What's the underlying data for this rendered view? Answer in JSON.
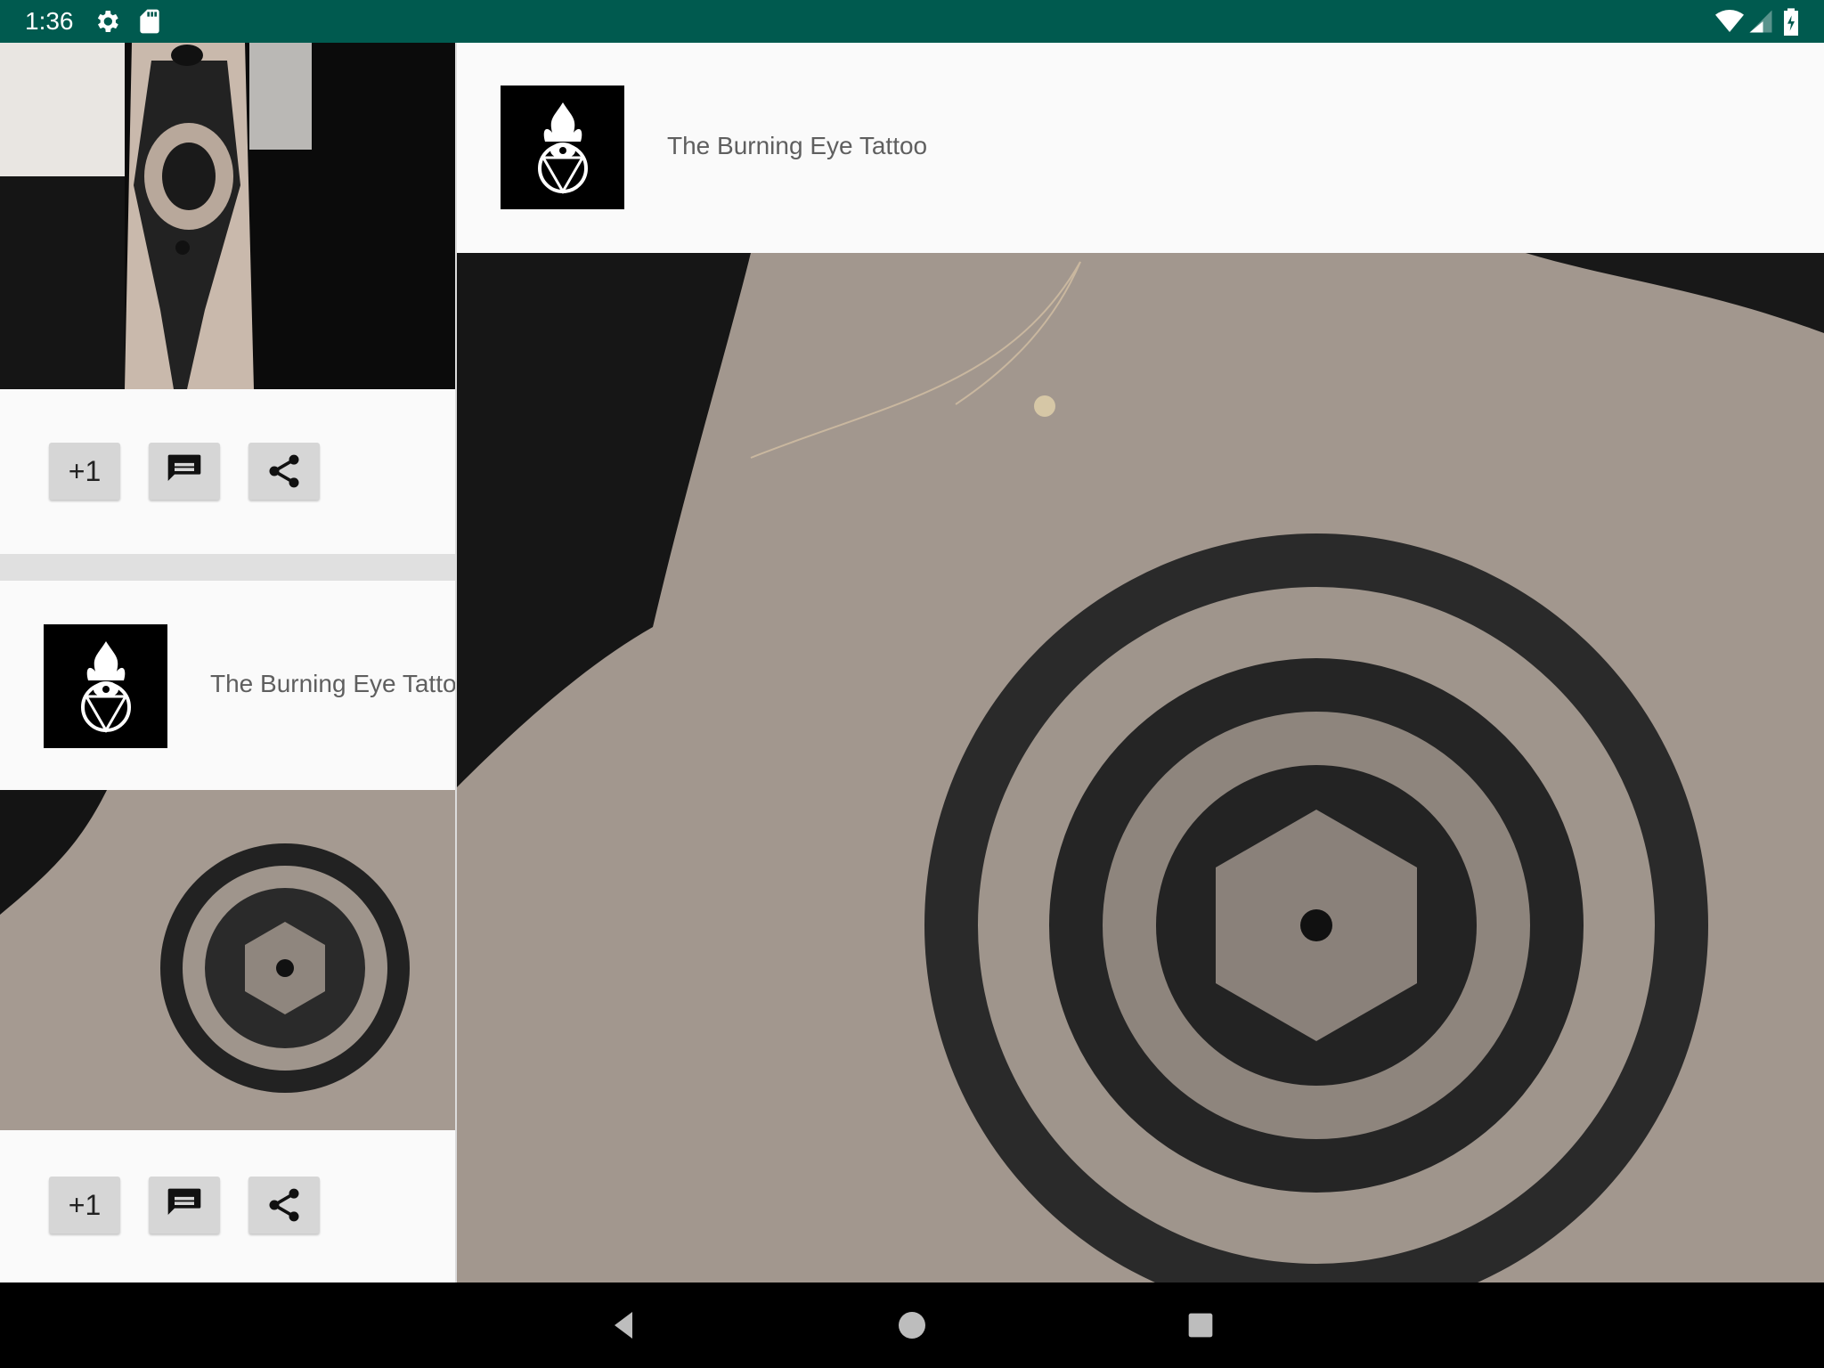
{
  "status_bar": {
    "time": "1:36",
    "icons_left": [
      "gear-icon",
      "sd-card-icon"
    ],
    "icons_right": [
      "wifi-icon",
      "signal-icon",
      "battery-icon"
    ],
    "background": "#005a4f"
  },
  "feed": {
    "posts": [
      {
        "author": "",
        "image": "forearm-tattoo-photo",
        "actions": {
          "plus_one": "+1",
          "comment_icon": "comment-icon",
          "share_icon": "share-icon"
        }
      },
      {
        "author": "The Burning Eye Tattoo",
        "image": "mandala-back-tattoo-photo",
        "actions": {
          "plus_one": "+1",
          "comment_icon": "comment-icon",
          "share_icon": "share-icon"
        }
      }
    ]
  },
  "detail": {
    "author": "The Burning Eye Tattoo",
    "image": "mandala-back-tattoo-photo-large"
  },
  "nav_bar": {
    "buttons": [
      "back-icon",
      "home-icon",
      "recents-icon"
    ]
  }
}
